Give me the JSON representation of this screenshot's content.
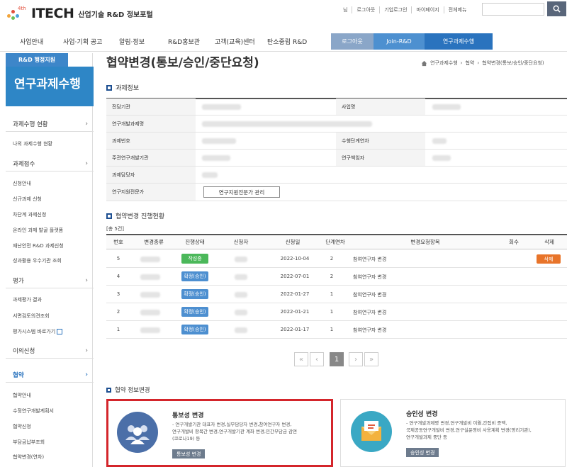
{
  "header": {
    "logo_badge": "4th",
    "logo_text": "ITECH",
    "logo_sub": "산업기술 R&D 정보포털",
    "top_links": [
      "님",
      "로그아웃",
      "기업로그인",
      "마이페이지",
      "전체메뉴"
    ]
  },
  "nav": {
    "items": [
      "사업안내",
      "사업·기획 공고",
      "알림·정보",
      "R&D홍보관",
      "고객(교육)센터",
      "탄소중립 R&D"
    ],
    "buttons": [
      "로그아웃",
      "Join-R&D",
      "연구과제수행"
    ],
    "colors": {
      "logout": "#8aa6c8",
      "join": "#4d90d0",
      "research": "#2a73be"
    }
  },
  "sidebar": {
    "badge": "R&D 행정지원",
    "title": "연구과제수행",
    "groups": [
      {
        "label": "과제수행 현황",
        "items": [
          "나의 과제수행 현황"
        ]
      },
      {
        "label": "과제접수",
        "items": [
          "신청안내",
          "신규과제 신청",
          "차단계 과제신청",
          "온라인 과제 발굴 플랫폼",
          "재난안전 R&D 과제신청",
          "성과활용 우수기관 조회"
        ]
      },
      {
        "label": "평가",
        "items": [
          "과제평가 결과",
          "서면검토의견조회",
          "평가시스템 바로가기"
        ]
      },
      {
        "label": "이의신청",
        "items": []
      },
      {
        "label": "협약",
        "items": [
          "협약안내",
          "수정연구개발계획서",
          "협약신청",
          "부담금납부조회",
          "협약변경(연차)"
        ]
      }
    ]
  },
  "page": {
    "title": "협약변경(통보/승인/중단요청)",
    "breadcrumb": [
      "연구과제수행",
      "협약",
      "협약변경(통보/승인/중단요청)"
    ]
  },
  "info": {
    "heading": "과제정보",
    "labels": {
      "agency": "전담기관",
      "business": "사업명",
      "project_name": "연구개발과제명",
      "project_no": "과제번호",
      "stage": "수행단계연차",
      "lead_org": "주관연구개발기관",
      "pi": "연구책임자",
      "manager": "과제담당자",
      "expert": "연구지원전문가"
    },
    "expert_button": "연구지원전문가 관리"
  },
  "changes": {
    "heading": "협약변경 진행현황",
    "count_text": "[총 5건]",
    "columns": [
      "번호",
      "변경종류",
      "진행상태",
      "신청자",
      "신청일",
      "단계연차",
      "변경요청항목",
      "회수",
      "삭제"
    ],
    "rows": [
      {
        "no": "5",
        "status": "작성중",
        "date": "2022-10-04",
        "stage": "2",
        "item": "참여연구자 변경",
        "delete": "삭제"
      },
      {
        "no": "4",
        "status": "확정(승인)",
        "date": "2022-07-01",
        "stage": "2",
        "item": "참여연구자 변경",
        "delete": ""
      },
      {
        "no": "3",
        "status": "확정(승인)",
        "date": "2022-01-27",
        "stage": "1",
        "item": "참여연구자 변경",
        "delete": ""
      },
      {
        "no": "2",
        "status": "확정(승인)",
        "date": "2022-01-21",
        "stage": "1",
        "item": "참여연구자 변경",
        "delete": ""
      },
      {
        "no": "1",
        "status": "확정(승인)",
        "date": "2022-01-17",
        "stage": "1",
        "item": "참여연구자 변경",
        "delete": ""
      }
    ],
    "status_colors": {
      "draft": "#4bb85a",
      "approved": "#4d8fd0"
    }
  },
  "pagination": {
    "first": "«",
    "prev": "‹",
    "current": "1",
    "next": "›",
    "last": "»"
  },
  "agreement": {
    "heading": "협약 정보변경",
    "cards": [
      {
        "title": "통보성 변경",
        "desc": [
          "- 연구개발기관 대표자 변경,실무담당자 변경,참여연구자 변경,",
          "연구개발비 항목간 변경,연구개발기관 계좌 변경,민간부담금 감면",
          "(코로나19) 등"
        ],
        "button": "통보성 변경"
      },
      {
        "title": "승인성 변경",
        "desc": [
          "- 연구개발과제명 변경,연구개발비 이월,간접비 증액,",
          "국제공동연구개발비 변경,연구실운영비 사용계획 변경(영리기관),",
          "연구개발과제 중단 등"
        ],
        "button": "승인성 변경"
      }
    ]
  }
}
